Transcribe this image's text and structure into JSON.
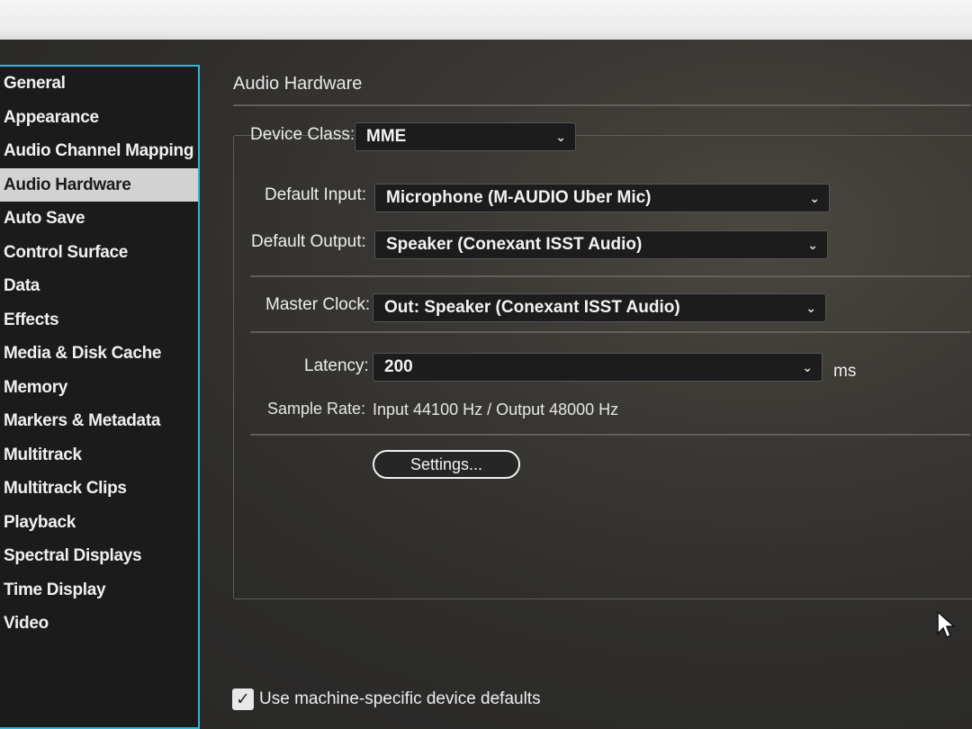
{
  "sidebar": {
    "items": [
      {
        "label": "General"
      },
      {
        "label": "Appearance"
      },
      {
        "label": "Audio Channel Mapping"
      },
      {
        "label": "Audio Hardware"
      },
      {
        "label": "Auto Save"
      },
      {
        "label": "Control Surface"
      },
      {
        "label": "Data"
      },
      {
        "label": "Effects"
      },
      {
        "label": "Media & Disk Cache"
      },
      {
        "label": "Memory"
      },
      {
        "label": "Markers & Metadata"
      },
      {
        "label": "Multitrack"
      },
      {
        "label": "Multitrack Clips"
      },
      {
        "label": "Playback"
      },
      {
        "label": "Spectral Displays"
      },
      {
        "label": "Time Display"
      },
      {
        "label": "Video"
      }
    ],
    "selected_index": 3,
    "accent_color": "#2fb6d6"
  },
  "panel": {
    "title": "Audio Hardware",
    "device_class": {
      "label": "Device Class:",
      "value": "MME"
    },
    "default_input": {
      "label": "Default Input:",
      "value": "Microphone (M-AUDIO Uber Mic)"
    },
    "default_output": {
      "label": "Default Output:",
      "value": "Speaker (Conexant ISST Audio)"
    },
    "master_clock": {
      "label": "Master Clock:",
      "value": "Out: Speaker (Conexant ISST Audio)"
    },
    "latency": {
      "label": "Latency:",
      "value": "200",
      "units": "ms"
    },
    "sample_rate": {
      "label": "Sample Rate:",
      "value": "Input 44100 Hz / Output 48000 Hz"
    },
    "settings_button": "Settings...",
    "machine_defaults": {
      "label": "Use machine-specific device defaults",
      "checked": true
    }
  },
  "icons": {
    "dropdown": "chevron-down-icon",
    "check": "checkmark-icon",
    "cursor": "mouse-pointer-icon"
  }
}
